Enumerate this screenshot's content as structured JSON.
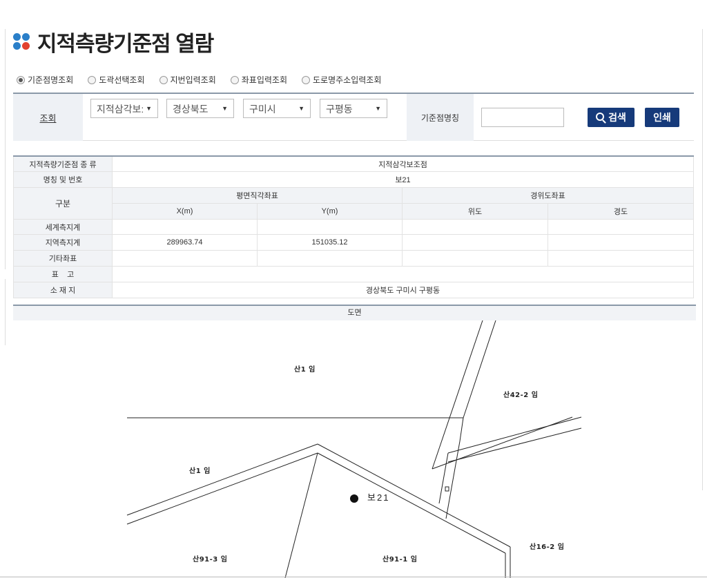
{
  "page": {
    "title": "지적측량기준점 열람"
  },
  "search_modes": [
    {
      "label": "기준점명조회",
      "selected": true
    },
    {
      "label": "도곽선택조회",
      "selected": false
    },
    {
      "label": "지번입력조회",
      "selected": false
    },
    {
      "label": "좌표입력조회",
      "selected": false
    },
    {
      "label": "도로명주소입력조회",
      "selected": false
    }
  ],
  "search": {
    "label": "조회",
    "type_select": "지적삼각보:",
    "province_select": "경상북도",
    "city_select": "구미시",
    "district_select": "구평동",
    "name_label": "기준점명칭",
    "name_value": "",
    "search_button": "검색",
    "print_button": "인쇄"
  },
  "info": {
    "type_label": "지적측량기준점 종 류",
    "type_value": "지적삼각보조점",
    "name_label": "명칭 및 번호",
    "name_value": "보21",
    "category_label": "구분",
    "plane_header": "평면직각좌표",
    "geo_header": "경위도좌표",
    "col_x": "X(m)",
    "col_y": "Y(m)",
    "col_lat": "위도",
    "col_lon": "경도",
    "rows": [
      {
        "label": "세계측지계",
        "x": "",
        "y": "",
        "lat": "",
        "lon": ""
      },
      {
        "label": "지역측지계",
        "x": "289963.74",
        "y": "151035.12",
        "lat": "",
        "lon": ""
      },
      {
        "label": "기타좌표",
        "x": "",
        "y": "",
        "lat": "",
        "lon": ""
      }
    ],
    "remark_label": "표    고",
    "remark_value": "",
    "location_label": "소 재 지",
    "location_value": "경상북도 구미시 구평동"
  },
  "map": {
    "header": "도면",
    "parcels": [
      "산1 임",
      "산42-2 임",
      "산1 임",
      "산91-3 임",
      "산91-1 임",
      "산16-2 임"
    ],
    "point_label": "보21"
  }
}
